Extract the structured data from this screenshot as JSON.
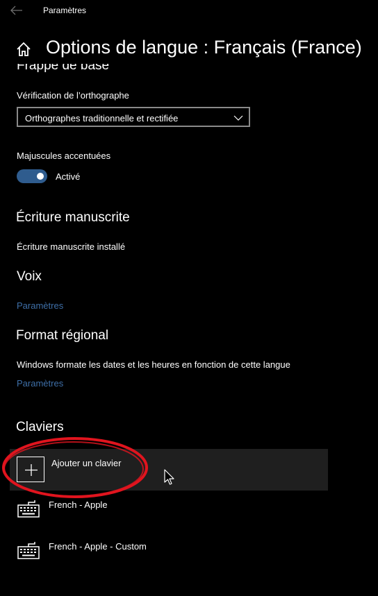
{
  "window": {
    "title": "Paramètres",
    "back_icon": "back-arrow-icon"
  },
  "header": {
    "home_icon": "home-icon",
    "title": "Options de langue : Français (France)"
  },
  "basic_typing": {
    "heading": "Frappe de base",
    "spellcheck_label": "Vérification de l’orthographe",
    "spellcheck_value": "Orthographes traditionnelle et rectifiée",
    "accented_caps_label": "Majuscules accentuées",
    "accented_caps_state": "Activé",
    "accented_caps_on": true
  },
  "handwriting": {
    "heading": "Écriture manuscrite",
    "status": "Écriture manuscrite installé"
  },
  "voice": {
    "heading": "Voix",
    "link": "Paramètres"
  },
  "regional_format": {
    "heading": "Format régional",
    "description": "Windows formate les dates et les heures en fonction de cette langue",
    "link": "Paramètres"
  },
  "keyboards": {
    "heading": "Claviers",
    "add_label": "Ajouter un clavier",
    "items": [
      {
        "label": "French - Apple",
        "icon": "keyboard-icon"
      },
      {
        "label": "French - Apple - Custom",
        "icon": "keyboard-icon"
      }
    ]
  },
  "colors": {
    "background": "#000000",
    "toggle_on": "#2f5c8e",
    "link": "#3e6fa8",
    "row_hover": "#1f1f1f",
    "annotation": "#e0141e"
  }
}
